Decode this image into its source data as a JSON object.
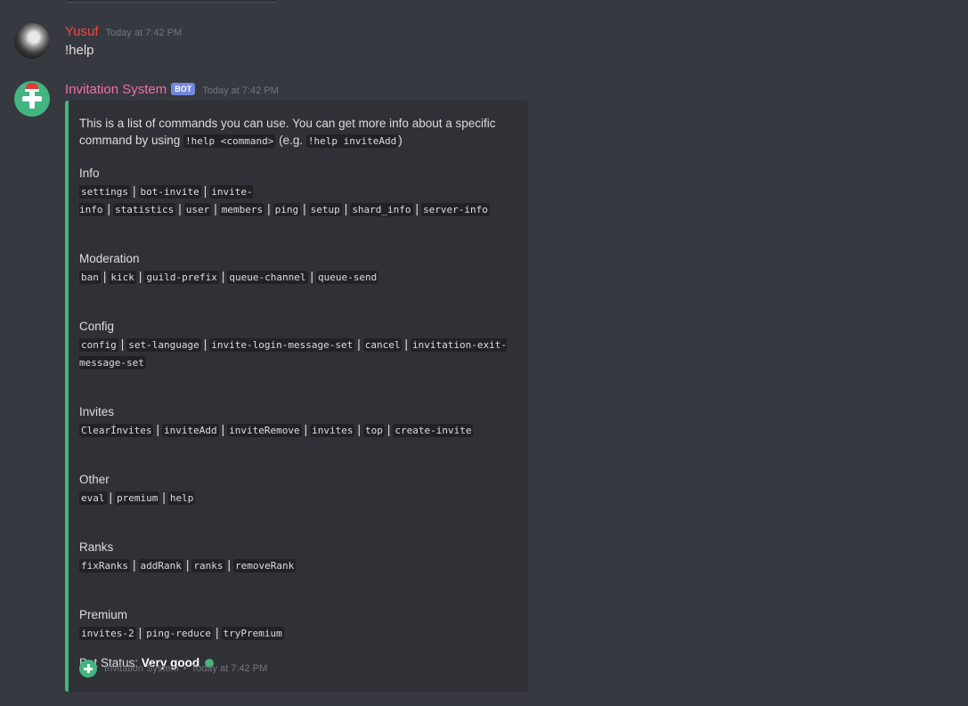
{
  "messages": [
    {
      "author": "Yusuf",
      "timestamp": "Today at 7:42 PM",
      "content": "!help",
      "author_color": "#f04747"
    },
    {
      "author": "Invitation System",
      "badge": "BOT",
      "timestamp": "Today at 7:42 PM",
      "author_color": "#f06fa8"
    }
  ],
  "embed": {
    "accent_color": "#43b581",
    "description": {
      "line1": "This is a list of commands you can use. You can get more info about a specific",
      "line2_prefix": "command by using ",
      "code1": "!help <command>",
      "mid": " (e.g. ",
      "code2": "!help inviteAdd",
      "suffix": ")"
    },
    "sections": [
      {
        "title": "Info",
        "commands": [
          "settings",
          "bot-invite",
          "invite-info",
          "statistics",
          "user",
          "members",
          "ping",
          "setup",
          "shard_info",
          "server-info"
        ]
      },
      {
        "title": "Moderation",
        "commands": [
          "ban",
          "kick",
          "guild-prefix",
          "queue-channel",
          "queue-send"
        ]
      },
      {
        "title": "Config",
        "commands": [
          "config",
          "set-language",
          "invite-login-message-set",
          "cancel",
          "invitation-exit-message-set"
        ]
      },
      {
        "title": "Invites",
        "commands": [
          "ClearÍnvites",
          "inviteAdd",
          "inviteRemove",
          "invites",
          "top",
          "create-invite"
        ]
      },
      {
        "title": "Other",
        "commands": [
          "eval",
          "premium",
          "help"
        ]
      },
      {
        "title": "Ranks",
        "commands": [
          "fixRanks",
          "addRank",
          "ranks",
          "removeRank"
        ]
      },
      {
        "title": "Premium",
        "commands": [
          "invites-2",
          "ping-reduce",
          "tryPremium"
        ]
      }
    ],
    "status_label": "Bot Status: ",
    "status_value": "Very good",
    "footer": {
      "name": "Invitation System",
      "separator": "•",
      "timestamp": "Today at 7:42 PM"
    }
  }
}
